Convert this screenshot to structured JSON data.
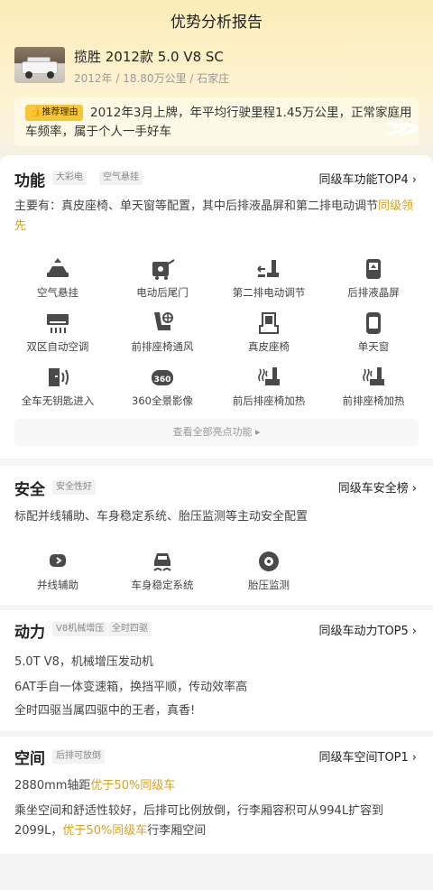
{
  "page": {
    "title": "优势分析报告"
  },
  "car": {
    "name": "揽胜 2012款 5.0 V8 SC",
    "meta": "2012年 / 18.80万公里 / 石家庄"
  },
  "reason": {
    "tag": "推荐理由",
    "text": "2012年3月上牌，年平均行驶里程1.45万公里，正常家庭用车频率，属于个人一手好车"
  },
  "function": {
    "title": "功能",
    "tags": [
      "大彩电",
      "空气悬挂"
    ],
    "rank": "同级车功能TOP4",
    "desc_main": "主要有：真皮座椅、单天窗等配置，其中后排液晶屏和第二排电动调节",
    "desc_hl": "同级领先",
    "features": [
      {
        "label": "空气悬挂",
        "icon": "air-suspension-icon"
      },
      {
        "label": "电动后尾门",
        "icon": "power-tailgate-icon"
      },
      {
        "label": "第二排电动调节",
        "icon": "second-row-power-seat-icon"
      },
      {
        "label": "后排液晶屏",
        "icon": "rear-screen-icon"
      },
      {
        "label": "双区自动空调",
        "icon": "dual-zone-ac-icon"
      },
      {
        "label": "前排座椅通风",
        "icon": "seat-ventilation-icon"
      },
      {
        "label": "真皮座椅",
        "icon": "leather-seat-icon"
      },
      {
        "label": "单天窗",
        "icon": "sunroof-icon"
      },
      {
        "label": "全车无钥匙进入",
        "icon": "keyless-entry-icon"
      },
      {
        "label": "360全景影像",
        "icon": "camera-360-icon"
      },
      {
        "label": "前后排座椅加热",
        "icon": "seat-heating-icon"
      },
      {
        "label": "前排座椅加热",
        "icon": "front-seat-heating-icon"
      }
    ],
    "see_all": "查看全部亮点功能 ▸"
  },
  "safety": {
    "title": "安全",
    "tags": [
      "安全性好"
    ],
    "rank": "同级车安全榜",
    "desc": "标配并线辅助、车身稳定系统、胎压监测等主动安全配置",
    "features": [
      {
        "label": "并线辅助",
        "icon": "lane-change-assist-icon"
      },
      {
        "label": "车身稳定系统",
        "icon": "stability-control-icon"
      },
      {
        "label": "胎压监测",
        "icon": "tire-pressure-icon"
      }
    ]
  },
  "power": {
    "title": "动力",
    "tags": [
      "V8机械增压",
      "全时四驱"
    ],
    "rank": "同级车动力TOP5",
    "lines": [
      "5.0T V8，机械增压发动机",
      "6AT手自一体变速箱，换挡平顺，传动效率高",
      "全时四驱当属四驱中的王者，真香!"
    ]
  },
  "space": {
    "title": "空间",
    "tags": [
      "后排可放倒"
    ],
    "rank": "同级车空间TOP1",
    "line1_a": "2880mm轴距",
    "line1_hl": "优于50%同级车",
    "line2_a": "乘坐空间和舒适性较好，后排可比例放倒，行李厢容积可从994L扩容到2099L，",
    "line2_hl": "优于50%同级车",
    "line2_b": "行李厢空间"
  },
  "colors": {
    "accent": "#d8a126",
    "tag_yellow": "#f6c538",
    "icon": "#4a4a4a"
  }
}
